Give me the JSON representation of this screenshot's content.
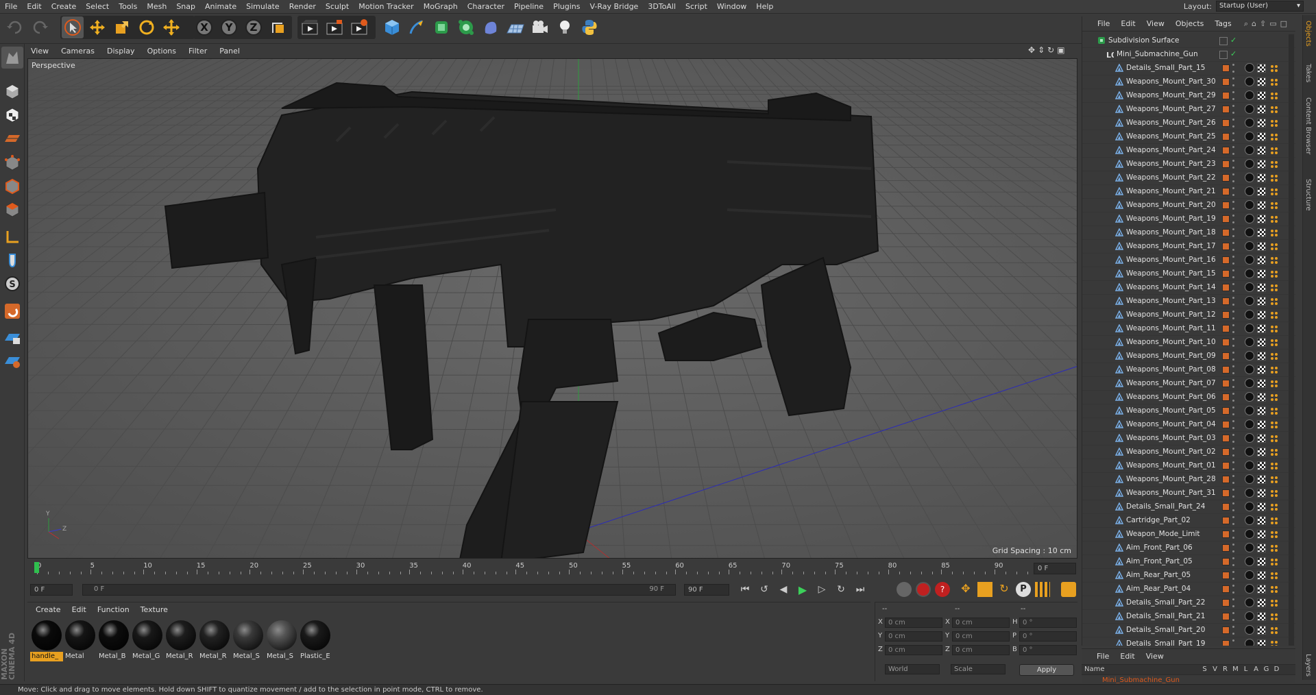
{
  "menubar": {
    "items": [
      "File",
      "Edit",
      "Create",
      "Select",
      "Tools",
      "Mesh",
      "Snap",
      "Animate",
      "Simulate",
      "Render",
      "Sculpt",
      "Motion Tracker",
      "MoGraph",
      "Character",
      "Pipeline",
      "Plugins",
      "V-Ray Bridge",
      "3DToAll",
      "Script",
      "Window",
      "Help"
    ],
    "layout_label": "Layout:",
    "layout_value": "Startup (User)"
  },
  "viewport": {
    "menu": [
      "View",
      "Cameras",
      "Display",
      "Options",
      "Filter",
      "Panel"
    ],
    "camera_label": "Perspective",
    "grid_spacing": "Grid Spacing : 10 cm"
  },
  "timeline": {
    "ticks": [
      "0",
      "5",
      "10",
      "15",
      "20",
      "25",
      "30",
      "35",
      "40",
      "45",
      "50",
      "55",
      "60",
      "65",
      "70",
      "75",
      "80",
      "85",
      "90"
    ],
    "end_frame_field": "0 F",
    "start_field": "0 F",
    "range_start": "0 F",
    "range_end": "90 F",
    "max_field": "90 F"
  },
  "materials": {
    "menu": [
      "Create",
      "Edit",
      "Function",
      "Texture"
    ],
    "items": [
      {
        "name": "handle_",
        "selected": true,
        "color": "#0a0a0a"
      },
      {
        "name": "Metal",
        "selected": false,
        "color": "#151515"
      },
      {
        "name": "Metal_B",
        "selected": false,
        "color": "#0c0c0c"
      },
      {
        "name": "Metal_G",
        "selected": false,
        "color": "#181818"
      },
      {
        "name": "Metal_R",
        "selected": false,
        "color": "#1d1d1d"
      },
      {
        "name": "Metal_R",
        "selected": false,
        "color": "#222222"
      },
      {
        "name": "Metal_S",
        "selected": false,
        "color": "#3a3a3a"
      },
      {
        "name": "Metal_S",
        "selected": false,
        "color": "#555555"
      },
      {
        "name": "Plastic_E",
        "selected": false,
        "color": "#1a1a1a"
      }
    ]
  },
  "coords": {
    "header_left": "--",
    "header_mid": "--",
    "header_right": "--",
    "rows": [
      {
        "a": "X",
        "av": "0 cm",
        "b": "X",
        "bv": "0 cm",
        "c": "H",
        "cv": "0 °"
      },
      {
        "a": "Y",
        "av": "0 cm",
        "b": "Y",
        "bv": "0 cm",
        "c": "P",
        "cv": "0 °"
      },
      {
        "a": "Z",
        "av": "0 cm",
        "b": "Z",
        "bv": "0 cm",
        "c": "B",
        "cv": "0 °"
      }
    ],
    "world": "World",
    "scale": "Scale",
    "apply": "Apply"
  },
  "status": "Move: Click and drag to move elements. Hold down SHIFT to quantize movement / add to the selection in point mode, CTRL to remove.",
  "objects": {
    "menu": [
      "File",
      "Edit",
      "View",
      "Objects",
      "Tags"
    ],
    "root": "Subdivision Surface",
    "group": "Mini_Submachine_Gun",
    "children": [
      "Details_Small_Part_15",
      "Weapons_Mount_Part_30",
      "Weapons_Mount_Part_29",
      "Weapons_Mount_Part_27",
      "Weapons_Mount_Part_26",
      "Weapons_Mount_Part_25",
      "Weapons_Mount_Part_24",
      "Weapons_Mount_Part_23",
      "Weapons_Mount_Part_22",
      "Weapons_Mount_Part_21",
      "Weapons_Mount_Part_20",
      "Weapons_Mount_Part_19",
      "Weapons_Mount_Part_18",
      "Weapons_Mount_Part_17",
      "Weapons_Mount_Part_16",
      "Weapons_Mount_Part_15",
      "Weapons_Mount_Part_14",
      "Weapons_Mount_Part_13",
      "Weapons_Mount_Part_12",
      "Weapons_Mount_Part_11",
      "Weapons_Mount_Part_10",
      "Weapons_Mount_Part_09",
      "Weapons_Mount_Part_08",
      "Weapons_Mount_Part_07",
      "Weapons_Mount_Part_06",
      "Weapons_Mount_Part_05",
      "Weapons_Mount_Part_04",
      "Weapons_Mount_Part_03",
      "Weapons_Mount_Part_02",
      "Weapons_Mount_Part_01",
      "Weapons_Mount_Part_28",
      "Weapons_Mount_Part_31",
      "Details_Small_Part_24",
      "Cartridge_Part_02",
      "Weapon_Mode_Limit",
      "Aim_Front_Part_06",
      "Aim_Front_Part_05",
      "Aim_Rear_Part_05",
      "Aim_Rear_Part_04",
      "Details_Small_Part_22",
      "Details_Small_Part_21",
      "Details_Small_Part_20",
      "Details_Small_Part_19"
    ]
  },
  "side_tabs": [
    "Objects",
    "Takes",
    "Content Browser",
    "Structure"
  ],
  "layers": {
    "menu": [
      "File",
      "Edit",
      "View"
    ],
    "head_name": "Name",
    "head_cols": [
      "S",
      "V",
      "R",
      "M",
      "L",
      "A",
      "G",
      "D"
    ],
    "row": "Mini_Submachine_Gun",
    "side_tab": "Layers"
  },
  "brand": "MAXON CINEMA 4D",
  "colors": {
    "accent_orange": "#d5692a",
    "bg": "#3a3a3a",
    "viewport": "#5b5b5b"
  }
}
